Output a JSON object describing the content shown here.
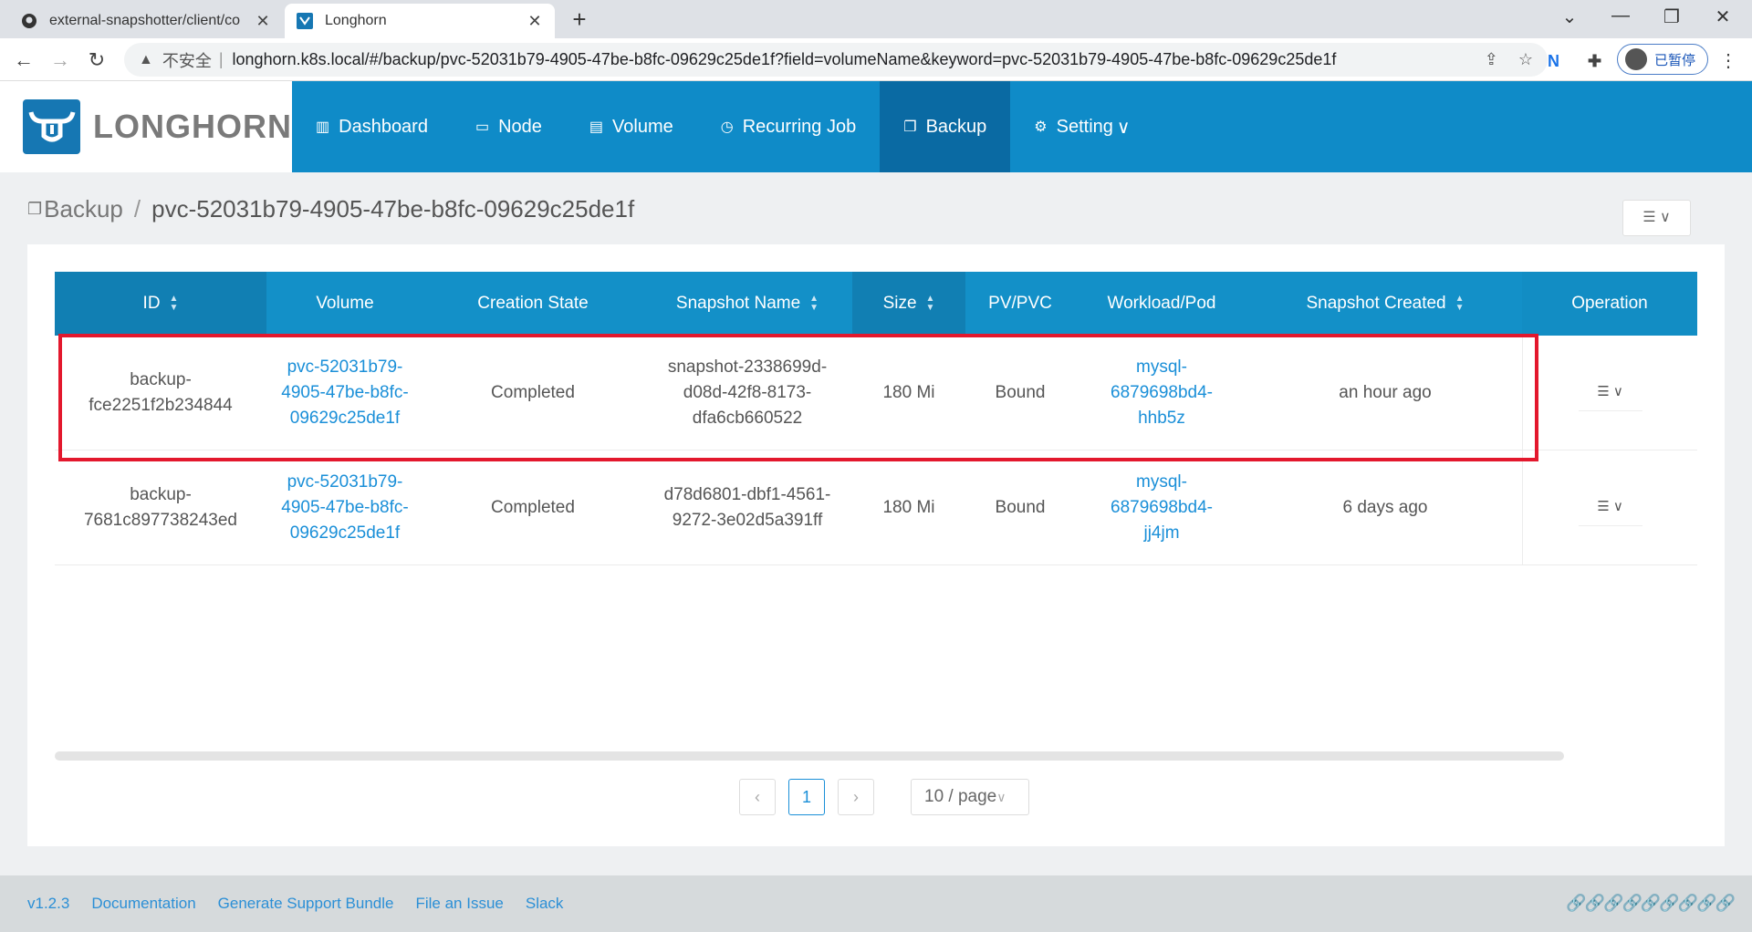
{
  "browser": {
    "tabs": [
      {
        "title": "external-snapshotter/client/co",
        "active": false
      },
      {
        "title": "Longhorn",
        "active": true
      }
    ],
    "omnibox": {
      "security_label": "不安全",
      "url": "longhorn.k8s.local/#/backup/pvc-52031b79-4905-47be-b8fc-09629c25de1f?field=volumeName&keyword=pvc-52031b79-4905-47be-b8fc-09629c25de1f"
    },
    "profile_label": "已暂停"
  },
  "app": {
    "logo_text": "LONGHORN",
    "nav": [
      {
        "label": "Dashboard",
        "icon": "chart-icon"
      },
      {
        "label": "Node",
        "icon": "laptop-icon"
      },
      {
        "label": "Volume",
        "icon": "database-icon"
      },
      {
        "label": "Recurring Job",
        "icon": "clock-icon"
      },
      {
        "label": "Backup",
        "icon": "copy-icon"
      },
      {
        "label": "Setting",
        "icon": "gear-icon"
      }
    ]
  },
  "breadcrumb": {
    "root": "Backup",
    "current": "pvc-52031b79-4905-47be-b8fc-09629c25de1f"
  },
  "table": {
    "headers": {
      "id": "ID",
      "volume": "Volume",
      "state": "Creation State",
      "snapshot": "Snapshot Name",
      "size": "Size",
      "pv": "PV/PVC",
      "workload": "Workload/Pod",
      "created": "Snapshot Created",
      "operation": "Operation"
    },
    "rows": [
      {
        "id": "backup-\nfce2251f2b234844",
        "volume": "pvc-52031b79-\n4905-47be-b8fc-\n09629c25de1f",
        "state": "Completed",
        "snapshot": "snapshot-2338699d-\nd08d-42f8-8173-\ndfa6cb660522",
        "size": "180 Mi",
        "pv": "Bound",
        "workload": "mysql-\n6879698bd4-\nhhb5z",
        "created": "an hour ago"
      },
      {
        "id": "backup-\n7681c897738243ed",
        "volume": "pvc-52031b79-\n4905-47be-b8fc-\n09629c25de1f",
        "state": "Completed",
        "snapshot": "d78d6801-dbf1-4561-\n9272-3e02d5a391ff",
        "size": "180 Mi",
        "pv": "Bound",
        "workload": "mysql-\n6879698bd4-\njj4jm",
        "created": "6 days ago"
      }
    ]
  },
  "pagination": {
    "current_page": "1",
    "page_size": "10 / page"
  },
  "footer": {
    "version": "v1.2.3",
    "links": [
      "Documentation",
      "Generate Support Bundle",
      "File an Issue",
      "Slack"
    ]
  },
  "colors": {
    "header_bg": "#0f8bc8",
    "active_nav": "#0a6aa3",
    "link": "#1a8fd8",
    "highlight_border": "#e3182d"
  }
}
